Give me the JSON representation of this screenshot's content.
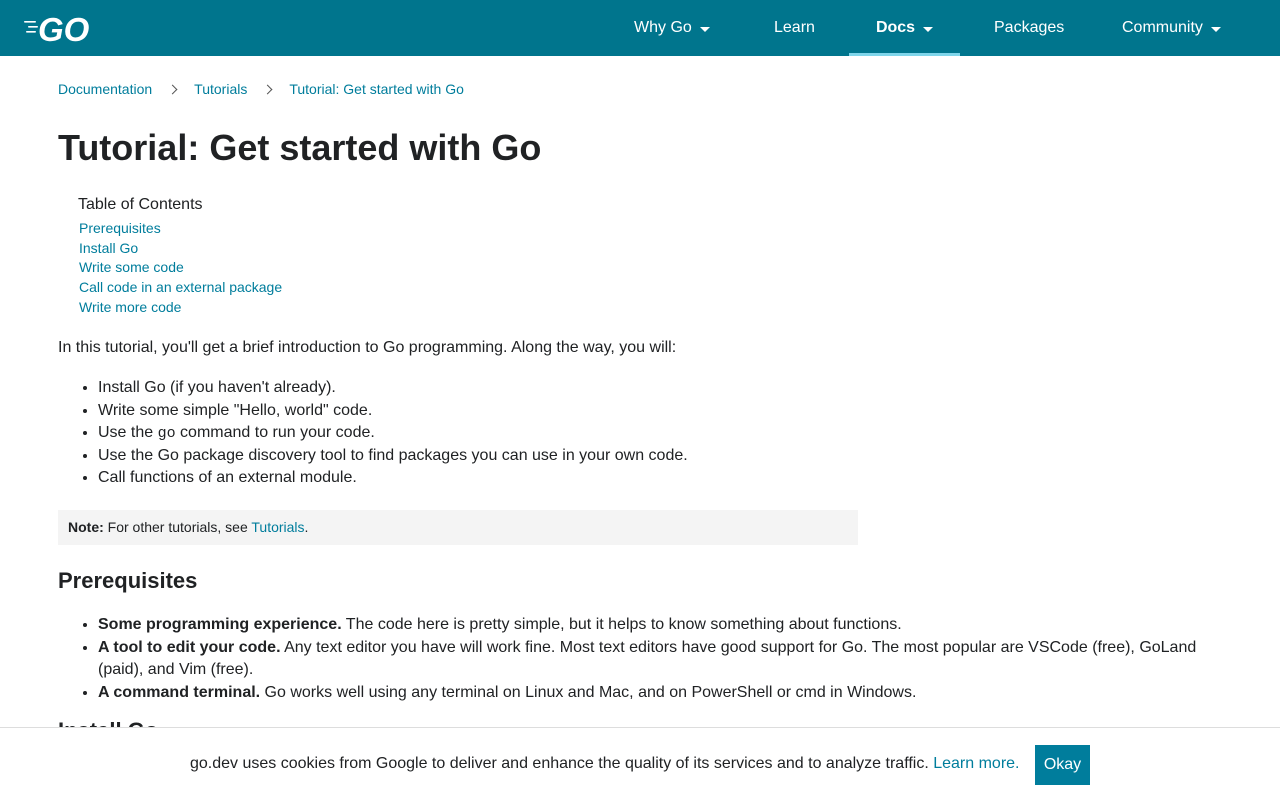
{
  "header": {
    "logo_text": "GO",
    "nav": [
      {
        "label": "Why Go",
        "has_menu": true
      },
      {
        "label": "Learn",
        "has_menu": false
      },
      {
        "label": "Docs",
        "has_menu": true,
        "active": true
      },
      {
        "label": "Packages",
        "has_menu": false
      },
      {
        "label": "Community",
        "has_menu": true
      }
    ],
    "colors": {
      "background": "#00758d",
      "active_underline": "#7fd5ea"
    }
  },
  "breadcrumb": [
    "Documentation",
    "Tutorials",
    "Tutorial: Get started with Go"
  ],
  "page_title": "Tutorial: Get started with Go",
  "toc": {
    "heading": "Table of Contents",
    "items": [
      "Prerequisites",
      "Install Go",
      "Write some code",
      "Call code in an external package",
      "Write more code"
    ]
  },
  "intro": "In this tutorial, you'll get a brief introduction to Go programming. Along the way, you will:",
  "bullets": {
    "b0": "Install Go (if you haven't already).",
    "b1": "Write some simple \"Hello, world\" code.",
    "b2_pre": "Use the ",
    "b2_code": "go",
    "b2_post": " command to run your code.",
    "b3": "Use the Go package discovery tool to find packages you can use in your own code.",
    "b4": "Call functions of an external module."
  },
  "note": {
    "label": "Note:",
    "text": " For other tutorials, see ",
    "link": "Tutorials",
    "end": "."
  },
  "prereq": {
    "heading": "Prerequisites",
    "items": [
      {
        "bold": "Some programming experience.",
        "text": " The code here is pretty simple, but it helps to know something about functions."
      },
      {
        "bold": "A tool to edit your code.",
        "text": " Any text editor you have will work fine. Most text editors have good support for Go. The most popular are VSCode (free), GoLand (paid), and Vim (free)."
      },
      {
        "bold": "A command terminal.",
        "text": " Go works well using any terminal on Linux and Mac, and on PowerShell or cmd in Windows."
      }
    ]
  },
  "next_heading": "Install Go",
  "cookie": {
    "text": "go.dev uses cookies from Google to deliver and enhance the quality of its services and to analyze traffic. ",
    "link": "Learn more.",
    "button": "Okay"
  },
  "colors": {
    "link": "#007d9c",
    "note_bg": "#f4f4f4",
    "text": "#202224"
  }
}
